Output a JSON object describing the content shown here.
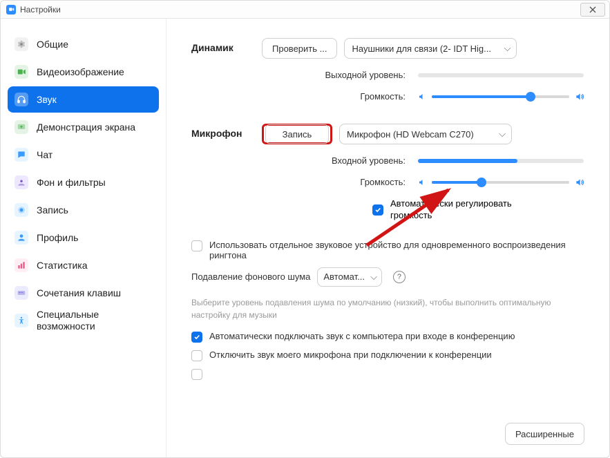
{
  "window": {
    "title": "Настройки"
  },
  "sidebar": {
    "items": [
      {
        "label": "Общие"
      },
      {
        "label": "Видеоизображение"
      },
      {
        "label": "Звук"
      },
      {
        "label": "Демонстрация экрана"
      },
      {
        "label": "Чат"
      },
      {
        "label": "Фон и фильтры"
      },
      {
        "label": "Запись"
      },
      {
        "label": "Профиль"
      },
      {
        "label": "Статистика"
      },
      {
        "label": "Сочетания клавиш"
      },
      {
        "label": "Специальные возможности"
      }
    ]
  },
  "speaker": {
    "section": "Динамик",
    "test_btn": "Проверить ...",
    "device": "Наушники для связи (2- IDT Hig...",
    "output_label": "Выходной уровень:",
    "volume_label": "Громкость:",
    "output_level_pct": 0,
    "volume_pct": 72
  },
  "mic": {
    "section": "Микрофон",
    "record_btn": "Запись",
    "device": "Микрофон (HD Webcam C270)",
    "input_label": "Входной уровень:",
    "volume_label": "Громкость:",
    "input_level_pct": 60,
    "volume_pct": 36,
    "auto_gain": "Автоматически регулировать громкость"
  },
  "options": {
    "separate_device": "Использовать отдельное звуковое устройство для одновременного воспроизведения рингтона",
    "noise_label": "Подавление фонового шума",
    "noise_value": "Автомат...",
    "noise_hint": "Выберите уровень подавления шума по умолчанию (низкий), чтобы выполнить оптимальную настройку для музыки",
    "auto_join": "Автоматически подключать звук с компьютера при входе в конференцию",
    "mute_on_join": "Отключить звук моего микрофона при подключении к конференции"
  },
  "footer": {
    "advanced": "Расширенные"
  }
}
